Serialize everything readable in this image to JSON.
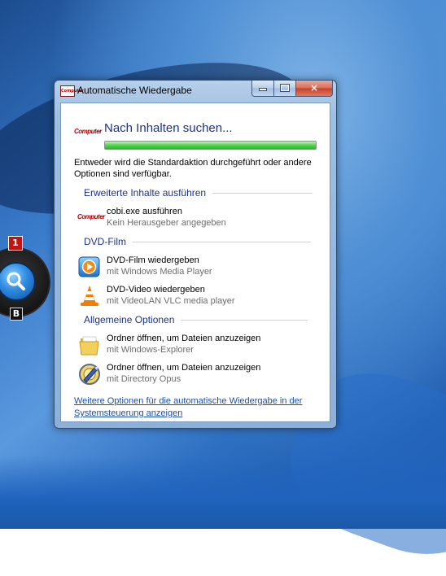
{
  "window": {
    "title": "Automatische Wiedergabe",
    "controls": {
      "minimize": "minimize",
      "maximize": "maximize",
      "close": "×"
    }
  },
  "header": {
    "logo_text": "Computer",
    "title": "Nach Inhalten suchen...",
    "progress_fraction": 1.0
  },
  "description": "Entweder wird die Standardaktion durchgeführt oder andere Optionen sind verfügbar.",
  "sections": [
    {
      "title": "Erweiterte Inhalte ausführen",
      "items": [
        {
          "icon": "computer-logo-icon",
          "line1": "cobi.exe ausführen",
          "line2": "Kein Herausgeber angegeben"
        }
      ]
    },
    {
      "title": "DVD-Film",
      "items": [
        {
          "icon": "media-player-icon",
          "line1": "DVD-Film wiedergeben",
          "line2": "mit Windows Media Player"
        },
        {
          "icon": "vlc-cone-icon",
          "line1": "DVD-Video wiedergeben",
          "line2": "mit VideoLAN VLC media player"
        }
      ]
    },
    {
      "title": "Allgemeine Optionen",
      "items": [
        {
          "icon": "folder-icon",
          "line1": "Ordner öffnen, um Dateien anzuzeigen",
          "line2": "mit Windows-Explorer"
        },
        {
          "icon": "directory-opus-icon",
          "line1": "Ordner öffnen, um Dateien anzuzeigen",
          "line2": "mit Directory Opus"
        }
      ]
    }
  ],
  "footer_link": "Weitere Optionen für die automatische Wiedergabe in der Systemsteuerung anzeigen",
  "desktop_gadget": {
    "badge_number": "1",
    "button_label": "B",
    "icon": "search-icon"
  },
  "colors": {
    "heading": "#1e3287",
    "link": "#1b4fa8",
    "progress": "#2fb42c"
  }
}
